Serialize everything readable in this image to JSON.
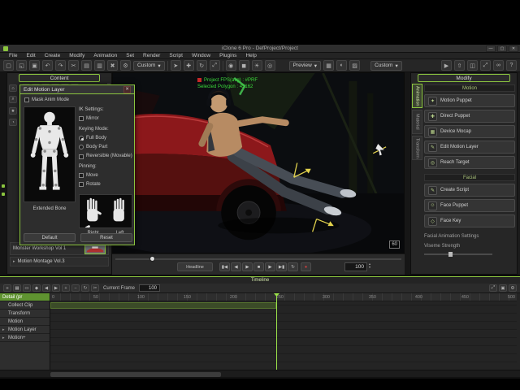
{
  "window": {
    "title": "iClone 6 Pro - DefProject/Project",
    "controls": {
      "min": "—",
      "max": "▢",
      "close": "✕"
    }
  },
  "menu": {
    "items": [
      "File",
      "Edit",
      "Create",
      "Modify",
      "Animation",
      "Set",
      "Render",
      "Script",
      "Window",
      "Plugins",
      "Help"
    ]
  },
  "toolbar": {
    "caret": "▾",
    "custom1": "Custom",
    "preview": "Preview",
    "custom2": "Custom",
    "left_icons": [
      {
        "name": "new-project-icon",
        "glyph": "▢"
      },
      {
        "name": "open-project-icon",
        "glyph": "◱"
      },
      {
        "name": "save-project-icon",
        "glyph": "▣"
      },
      {
        "name": "undo-icon",
        "glyph": "↶"
      },
      {
        "name": "redo-icon",
        "glyph": "↷"
      },
      {
        "name": "cut-icon",
        "glyph": "✂"
      },
      {
        "name": "copy-icon",
        "glyph": "▤"
      },
      {
        "name": "paste-icon",
        "glyph": "▥"
      },
      {
        "name": "delete-icon",
        "glyph": "✖"
      },
      {
        "name": "preferences-icon",
        "glyph": "⚙"
      }
    ],
    "tool_icons": [
      {
        "name": "select-tool-icon",
        "glyph": "➤"
      },
      {
        "name": "move-tool-icon",
        "glyph": "✚"
      },
      {
        "name": "rotate-tool-icon",
        "glyph": "↻"
      },
      {
        "name": "scale-tool-icon",
        "glyph": "⤢"
      }
    ],
    "create_icons": [
      {
        "name": "add-avatar-icon",
        "glyph": "◉"
      },
      {
        "name": "add-prop-icon",
        "glyph": "◼"
      },
      {
        "name": "add-light-icon",
        "glyph": "☀"
      },
      {
        "name": "add-camera-icon",
        "glyph": "◎"
      }
    ],
    "view_icons": [
      {
        "name": "grid-view-icon",
        "glyph": "▦"
      },
      {
        "name": "shadow-view-icon",
        "glyph": "◐"
      },
      {
        "name": "texture-view-icon",
        "glyph": "▨"
      }
    ],
    "right_icons": [
      {
        "name": "render-icon",
        "glyph": "▶"
      },
      {
        "name": "export-icon",
        "glyph": "⇧"
      },
      {
        "name": "snapshot-icon",
        "glyph": "◫"
      },
      {
        "name": "fullscreen-icon",
        "glyph": "⤢"
      },
      {
        "name": "link-icon",
        "glyph": "∞"
      },
      {
        "name": "help-icon",
        "glyph": "?"
      }
    ]
  },
  "content": {
    "title": "Content",
    "tab_icons": [
      {
        "name": "actor-tab-icon",
        "glyph": "◉"
      },
      {
        "name": "prop-tab-icon",
        "glyph": "◼"
      },
      {
        "name": "scene-tab-icon",
        "glyph": "⌂"
      },
      {
        "name": "light-tab-icon",
        "glyph": "☀"
      },
      {
        "name": "camera-tab-icon",
        "glyph": "◎"
      },
      {
        "name": "effect-tab-icon",
        "glyph": "✳"
      }
    ],
    "side_icons": [
      {
        "name": "home-icon",
        "glyph": "⌂"
      },
      {
        "name": "search-icon",
        "glyph": "⌕"
      },
      {
        "name": "favorites-icon",
        "glyph": "★"
      },
      {
        "name": "recent-icon",
        "glyph": "◔"
      }
    ],
    "library": {
      "arrow": "▸",
      "item1": "Monster Workshop Vol 1",
      "item2": "Motion Montage Vol.3"
    }
  },
  "dialog": {
    "title": "Edit Motion Layer",
    "close": "✕",
    "mask_label": "Mask Anim Mode",
    "ik_label": "IK Settings:",
    "mirror_label": "Mirror",
    "keying_label": "Keying Mode:",
    "full_body": "Full Body",
    "body_part": "Body Part",
    "reversible": "Reversible (Movable)",
    "pinning": "Pinning:",
    "move": "Move",
    "rotate": "Rotate",
    "extended_bone": "Extended Bone",
    "right": "Right",
    "left": "Left",
    "default": "Default",
    "reset": "Reset"
  },
  "viewport": {
    "overlay_line1": "Project FPS(avg) : #PRF",
    "overlay_line2": "Selected Polygon : 45162",
    "fps_badge": "60"
  },
  "transport": {
    "headline": "Headline",
    "frame": "100",
    "up": "▴",
    "down": "▾",
    "record": "●",
    "buttons": [
      {
        "name": "go-to-start-button",
        "glyph": "▮◀"
      },
      {
        "name": "previous-frame-button",
        "glyph": "◀"
      },
      {
        "name": "play-button",
        "glyph": "▶"
      },
      {
        "name": "stop-button",
        "glyph": "■"
      },
      {
        "name": "next-frame-button",
        "glyph": "▶"
      },
      {
        "name": "go-to-end-button",
        "glyph": "▶▮"
      },
      {
        "name": "loop-button",
        "glyph": "↻"
      }
    ]
  },
  "modify": {
    "title": "Modify",
    "tabs": [
      "Animation",
      "Material",
      "Transform"
    ],
    "motion_header": "Motion",
    "motion_buttons": [
      {
        "name": "motion-puppet-button",
        "icon": "✦",
        "label": "Motion Puppet"
      },
      {
        "name": "direct-puppet-button",
        "icon": "✚",
        "label": "Direct Puppet"
      },
      {
        "name": "device-mocap-button",
        "icon": "▦",
        "label": "Device Mocap"
      },
      {
        "name": "edit-motion-layer-button",
        "icon": "✎",
        "label": "Edit Motion Layer"
      },
      {
        "name": "reach-target-button",
        "icon": "◎",
        "label": "Reach Target"
      }
    ],
    "facial_header": "Facial",
    "facial_buttons": [
      {
        "name": "create-script-button",
        "icon": "✎",
        "label": "Create Script"
      },
      {
        "name": "face-puppet-button",
        "icon": "☺",
        "label": "Face Puppet"
      },
      {
        "name": "face-key-button",
        "icon": "◇",
        "label": "Face Key"
      }
    ],
    "settings_title": "Facial Animation Settings",
    "viseme_label": "Viseme Strength"
  },
  "timeline": {
    "title": "Timeline",
    "current_frame_label": "Current Frame",
    "frame": "100",
    "icons_left": [
      {
        "name": "track-list-icon",
        "glyph": "≡"
      },
      {
        "name": "object-related-tracks-icon",
        "glyph": "▦"
      },
      {
        "name": "collect-clip-icon",
        "glyph": "▭"
      },
      {
        "name": "add-key-icon",
        "glyph": "◆"
      },
      {
        "name": "previous-key-icon",
        "glyph": "◀"
      },
      {
        "name": "next-key-icon",
        "glyph": "▶"
      },
      {
        "name": "zoom-in-icon",
        "glyph": "+"
      },
      {
        "name": "zoom-out-icon",
        "glyph": "−"
      },
      {
        "name": "loop-icon",
        "glyph": "↻"
      },
      {
        "name": "break-clip-icon",
        "glyph": "✂"
      }
    ],
    "icons_right": [
      {
        "name": "zoom-fit-icon",
        "glyph": "⤢"
      },
      {
        "name": "snap-icon",
        "glyph": "▣"
      },
      {
        "name": "timeline-settings-icon",
        "glyph": "⚙"
      }
    ],
    "ruler": [
      "0",
      "50",
      "100",
      "150",
      "200",
      "250",
      "300",
      "350",
      "400",
      "450",
      "500"
    ],
    "track_selected": "Detail (pr",
    "tracks": [
      {
        "arrow": "",
        "label": "Collect Clip"
      },
      {
        "arrow": "",
        "label": "Transform"
      },
      {
        "arrow": "",
        "label": "Motion"
      },
      {
        "arrow": "▸",
        "label": "Motion Layer"
      },
      {
        "arrow": "▸",
        "label": "Motion+"
      }
    ]
  }
}
